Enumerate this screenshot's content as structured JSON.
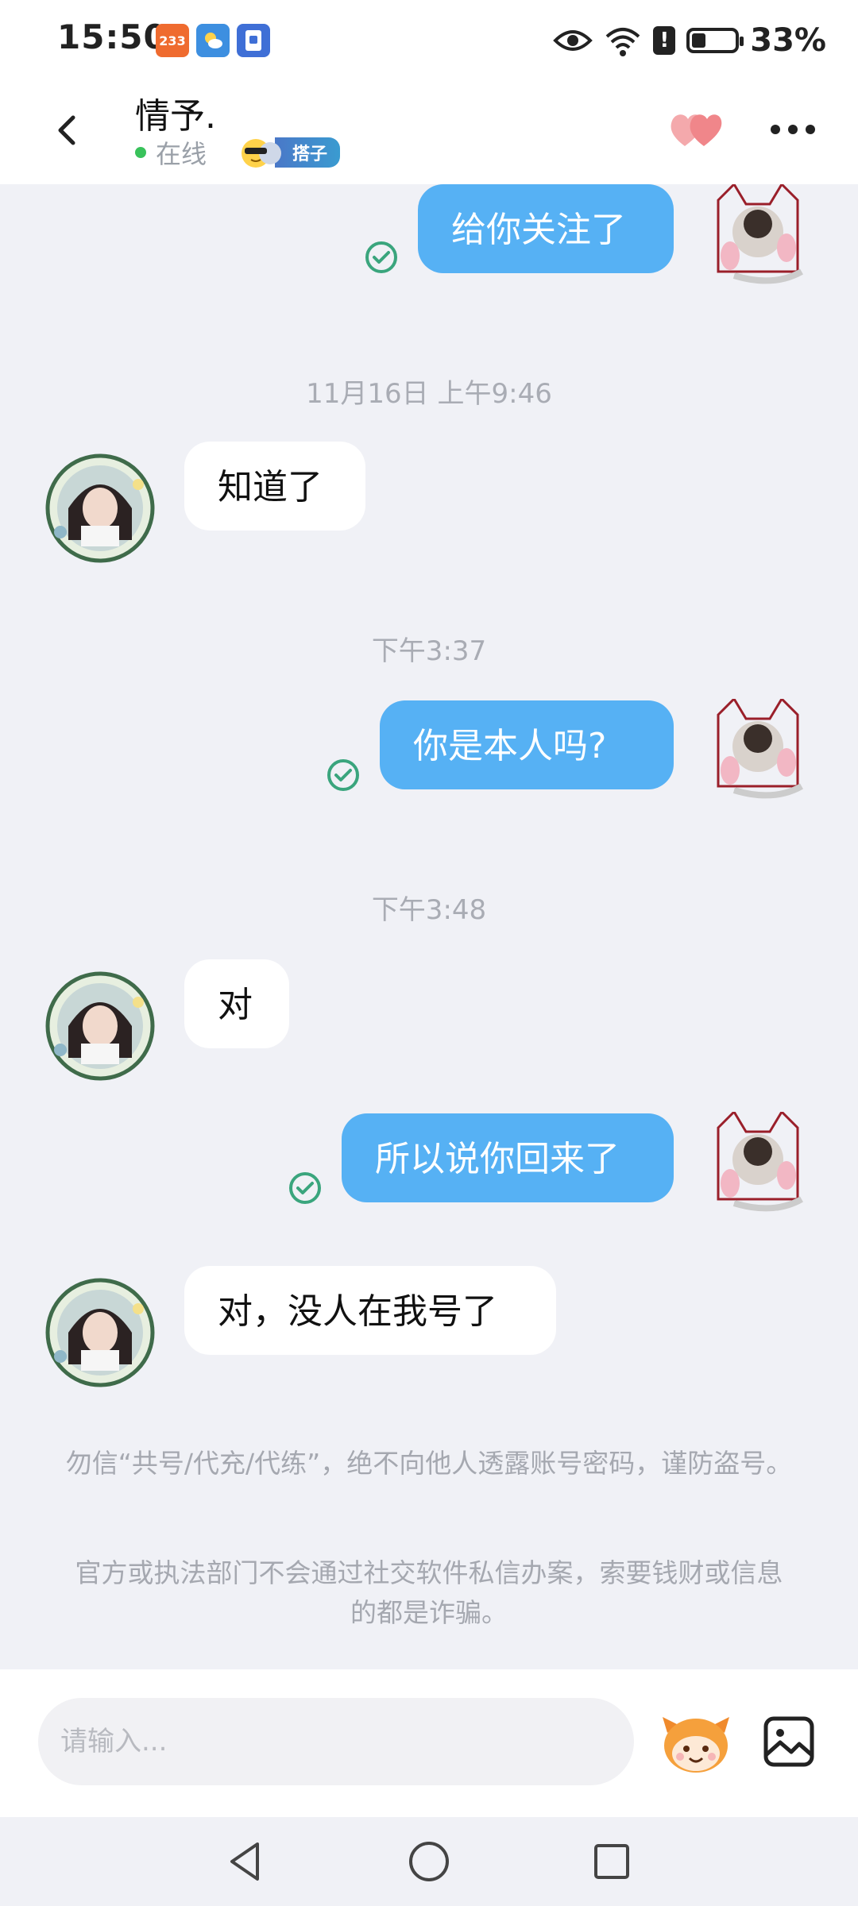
{
  "status_bar": {
    "time": "15:50",
    "app_badges": [
      "233"
    ],
    "battery_percent": "33%",
    "battery_level": 0.33
  },
  "header": {
    "contact_name": "情予.",
    "status": "在线",
    "partner_tag": "搭子"
  },
  "messages": [
    {
      "direction": "out",
      "text": "给你关注了",
      "read": true
    },
    {
      "type": "time",
      "text": "11月16日 上午9:46"
    },
    {
      "direction": "in",
      "text": "知道了"
    },
    {
      "type": "time",
      "text": "下午3:37"
    },
    {
      "direction": "out",
      "text": "你是本人吗?",
      "read": true
    },
    {
      "type": "time",
      "text": "下午3:48"
    },
    {
      "direction": "in",
      "text": "对"
    },
    {
      "direction": "out",
      "text": "所以说你回来了",
      "read": true
    },
    {
      "direction": "in",
      "text": "对，没人在我号了"
    }
  ],
  "notices": [
    "勿信“共号/代充/代练”，绝不向他人透露账号密码，谨防盗号。",
    "官方或执法部门不会通过社交软件私信办案，索要钱财或信息的都是诈骗。"
  ],
  "input": {
    "placeholder": "请输入..."
  },
  "colors": {
    "outgoing_bubble": "#56b1f4",
    "incoming_bubble": "#ffffff",
    "background": "#f0f1f6",
    "read_check": "#3aa57d",
    "online_dot": "#39c25b",
    "heart": "#f0868a"
  },
  "icons": {
    "back": "chevron-left-icon",
    "hearts": "hearts-icon",
    "more": "more-horizontal-icon",
    "read": "check-circle-icon",
    "emoji": "emoji-face-icon",
    "image": "image-icon",
    "nav_back": "triangle-back-icon",
    "nav_home": "circle-home-icon",
    "nav_recent": "square-recent-icon"
  }
}
